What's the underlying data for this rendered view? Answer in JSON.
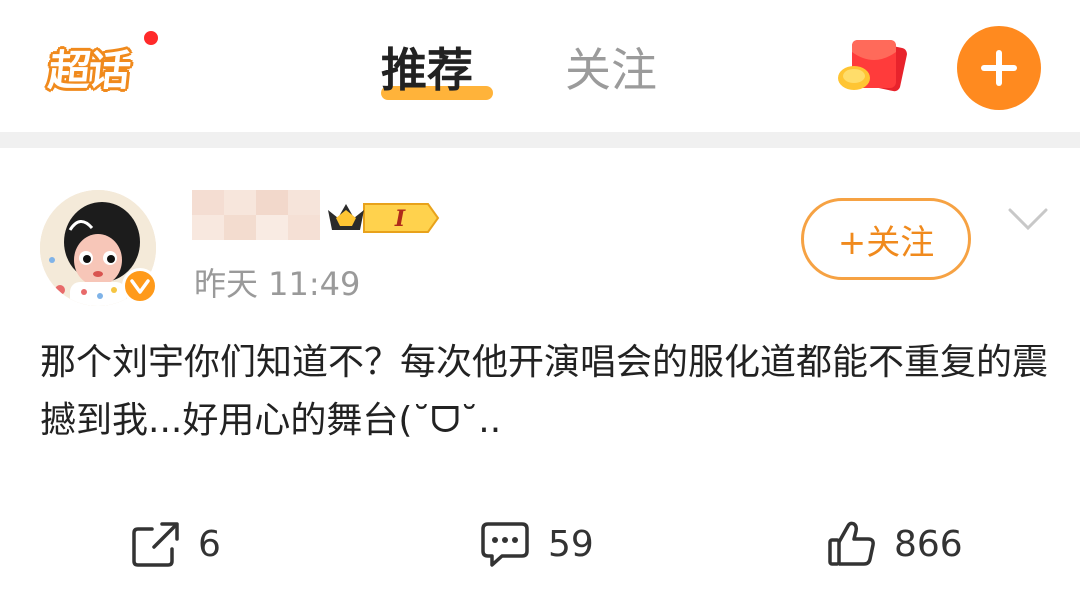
{
  "header": {
    "logo_text": "超话",
    "tabs": [
      {
        "label": "推荐",
        "active": true
      },
      {
        "label": "关注",
        "active": false
      }
    ],
    "icons": {
      "redpack": "red-envelope-icon",
      "compose": "plus-icon"
    },
    "accent_color": "#ff8a1f"
  },
  "post": {
    "time": "昨天 11:49",
    "rank_badge": "I",
    "follow_label": "+关注",
    "text": "那个刘宇你们知道不？每次他开演唱会的服化道都能不重复的震撼到我...好用心的舞台(˘ᗜ˘..",
    "actions": {
      "repost_count": "6",
      "comment_count": "59",
      "like_count": "866"
    }
  }
}
